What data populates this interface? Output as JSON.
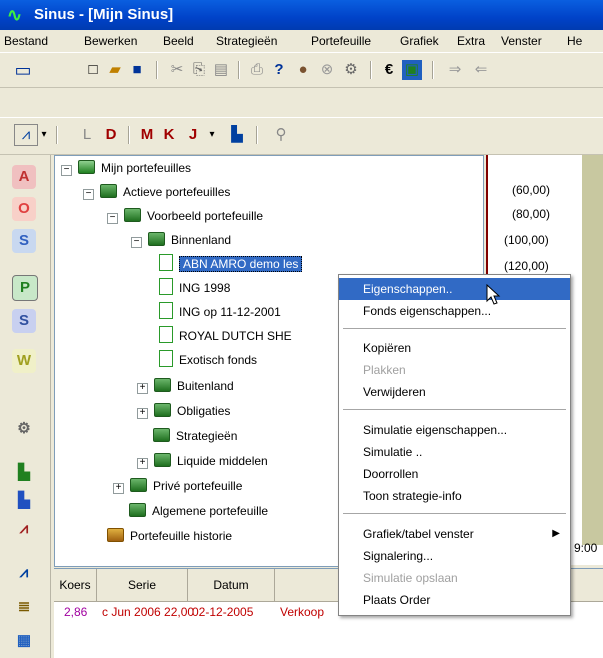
{
  "window": {
    "app_icon": "sinus-logo-icon",
    "title": "Sinus - [Mijn Sinus]"
  },
  "menu": [
    "Bestand",
    "Bewerken",
    "Beeld",
    "Strategieën",
    "Portefeuille",
    "Grafiek",
    "Extra",
    "Venster",
    "He"
  ],
  "toolbar1": {
    "buttons": [
      {
        "name": "screen-icon",
        "glyph": "▭"
      },
      {
        "name": "new-doc-icon",
        "glyph": "□"
      },
      {
        "name": "open-folder-icon",
        "glyph": "📂"
      },
      {
        "name": "save-icon",
        "glyph": "■"
      },
      {
        "name": "cut-icon",
        "glyph": "✂"
      },
      {
        "name": "copy-icon",
        "glyph": "⎘"
      },
      {
        "name": "paste-icon",
        "glyph": "📋"
      },
      {
        "name": "print-icon",
        "glyph": "⎙"
      },
      {
        "name": "help-pointer-icon",
        "glyph": "?"
      },
      {
        "name": "bear-icon",
        "glyph": "●"
      },
      {
        "name": "stop-icon",
        "glyph": "⊗"
      },
      {
        "name": "properties-icon",
        "glyph": "⚙"
      },
      {
        "name": "euro-icon",
        "glyph": "€"
      },
      {
        "name": "globe-icon",
        "glyph": "▣"
      },
      {
        "name": "forward-icon",
        "glyph": "⇒"
      },
      {
        "name": "back-icon",
        "glyph": "⇐"
      }
    ]
  },
  "toolbar2": {
    "buttons": [
      {
        "name": "chart-type-icon",
        "glyph": "⩘"
      },
      {
        "name": "dropdown-arrow-icon",
        "glyph": "▾"
      },
      {
        "name": "chart-circle-icon",
        "glyph": "L"
      },
      {
        "name": "chart-d-icon",
        "glyph": "D"
      },
      {
        "name": "chart-m-icon",
        "glyph": "M"
      },
      {
        "name": "chart-k-icon",
        "glyph": "K"
      },
      {
        "name": "chart-j-icon",
        "glyph": "J"
      },
      {
        "name": "dropdown-arrow-icon-2",
        "glyph": "▾"
      },
      {
        "name": "chart-bars-icon",
        "glyph": "▙"
      },
      {
        "name": "search-icon",
        "glyph": "⚲"
      }
    ]
  },
  "leftbar": [
    {
      "name": "app-a-icon",
      "glyph": "A",
      "bg": "#d05050"
    },
    {
      "name": "app-o-icon",
      "glyph": "O",
      "bg": "#e04040"
    },
    {
      "name": "app-s-icon",
      "glyph": "S",
      "bg": "#3070d0"
    },
    {
      "name": "app-p-icon",
      "glyph": "P",
      "bg": "#30a030"
    },
    {
      "name": "app-si-icon",
      "glyph": "S",
      "bg": "#4060b0"
    },
    {
      "name": "app-w-icon",
      "glyph": "W",
      "bg": "#c0c040"
    },
    {
      "name": "properties-side-icon",
      "glyph": "⚙",
      "bg": "#d8d5c5"
    },
    {
      "name": "chart-green-icon",
      "glyph": "▙",
      "bg": "#d8d5c5"
    },
    {
      "name": "chart-blue-icon",
      "glyph": "▙",
      "bg": "#d8d5c5"
    },
    {
      "name": "chart-signal-icon",
      "glyph": "⩘",
      "bg": "#d8d5c5"
    },
    {
      "name": "chart-line-icon",
      "glyph": "⩘",
      "bg": "#d8d5c5"
    },
    {
      "name": "ledger-icon",
      "glyph": "≣",
      "bg": "#d8d5c5"
    },
    {
      "name": "calendar-icon",
      "glyph": "▦",
      "bg": "#d8d5c5"
    }
  ],
  "tree": {
    "root": "Mijn portefeuilles",
    "active": "Actieve portefeuilles",
    "example": "Voorbeeld portefeuille",
    "binnenland": "Binnenland",
    "items": [
      "ABN AMRO demo les",
      "ING 1998",
      "ING op 11-12-2001",
      "ROYAL DUTCH SHE",
      "Exotisch fonds"
    ],
    "buitenland": "Buitenland",
    "obligaties": "Obligaties",
    "strategieen": "Strategieën",
    "liquide": "Liquide middelen",
    "prive": "Privé portefeuille",
    "algemene": "Algemene portefeuille",
    "historie": "Portefeuille historie"
  },
  "chart": {
    "ticks": [
      "(60,00)",
      "(80,00)",
      "(100,00)",
      "(120,00)"
    ],
    "time_label": "9:00"
  },
  "table": {
    "headers": [
      "Koers",
      "Serie",
      "Datum"
    ],
    "row": {
      "koers": "2,86",
      "serie": "c Jun 2006  22,00",
      "datum": "02-12-2005",
      "extra": "Verkoop"
    }
  },
  "context_menu": {
    "group1": [
      "Eigenschappen..",
      "Fonds eigenschappen..."
    ],
    "group2": [
      "Kopiëren",
      "Plakken",
      "Verwijderen"
    ],
    "group3": [
      "Simulatie eigenschappen...",
      "Simulatie ..",
      "Doorrollen",
      "Toon strategie-info"
    ],
    "group4": [
      "Grafiek/tabel venster",
      "Signalering...",
      "Simulatie opslaan",
      "Plaats Order"
    ]
  }
}
